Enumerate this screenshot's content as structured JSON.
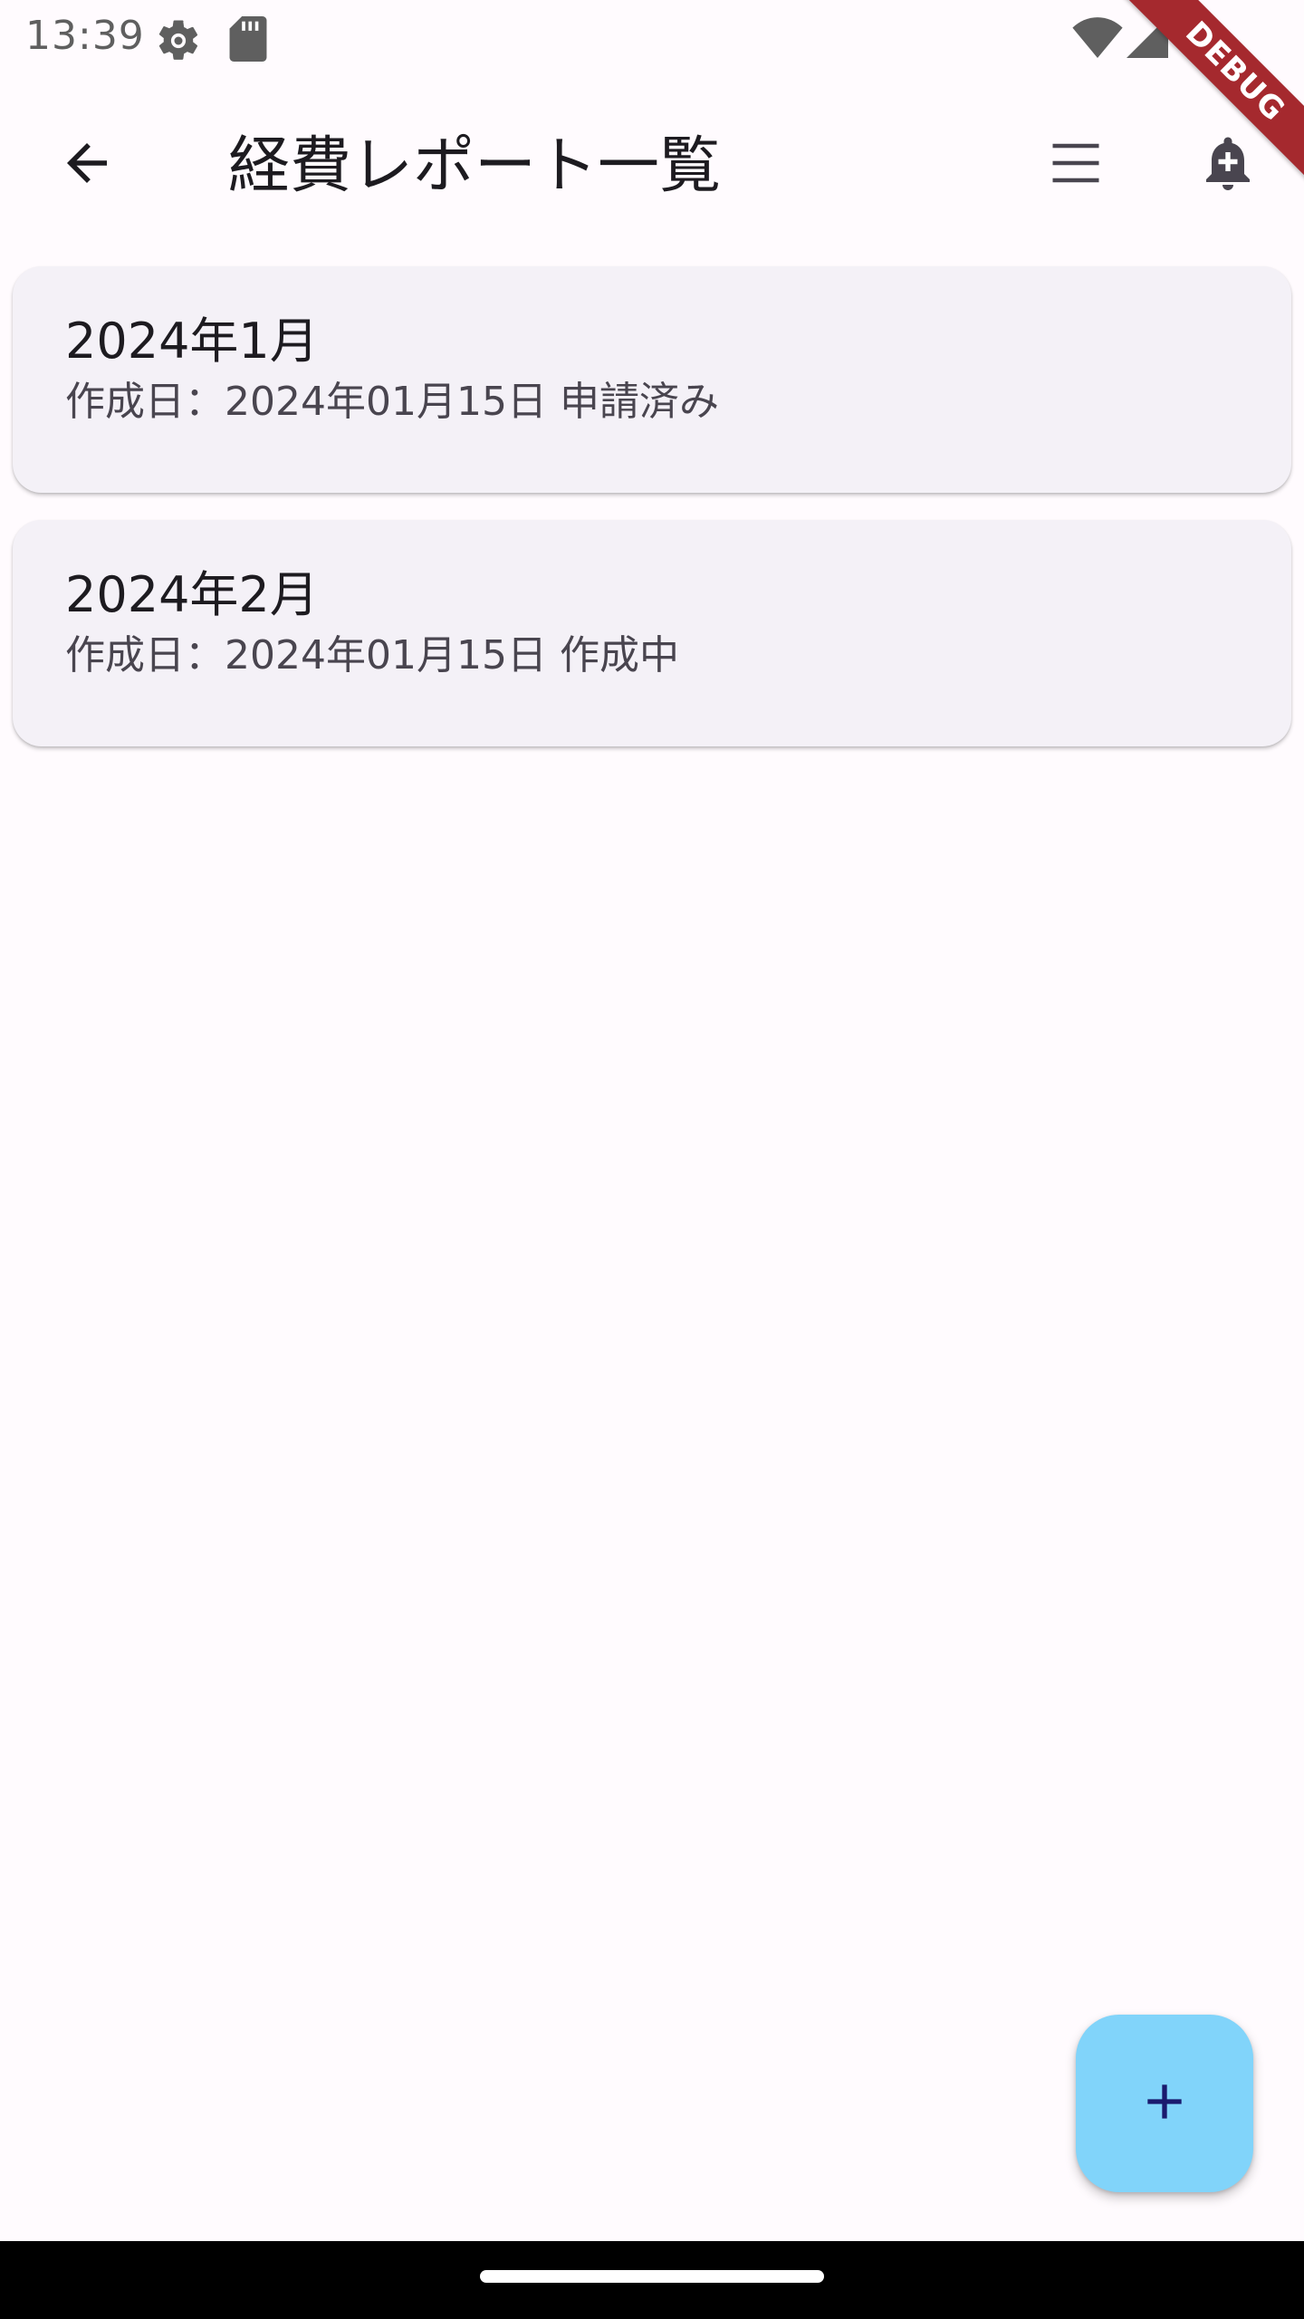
{
  "status_bar": {
    "time": "13:39",
    "icons": [
      "settings-gear-icon",
      "sd-card-icon",
      "wifi-icon",
      "signal-icon",
      "battery-icon"
    ]
  },
  "debug_banner": {
    "label": "DEBUG"
  },
  "app_bar": {
    "title": "経費レポート一覧",
    "back_icon": "arrow-back-icon",
    "menu_icon": "menu-icon",
    "notification_icon": "notification-add-icon"
  },
  "reports": [
    {
      "title": "2024年1月",
      "subtitle": "作成日：2024年01月15日 申請済み"
    },
    {
      "title": "2024年2月",
      "subtitle": "作成日：2024年01月15日 作成中"
    }
  ],
  "fab": {
    "icon": "add-icon"
  },
  "colors": {
    "background": "#fffbfe",
    "card": "#f4f1f7",
    "fab": "#81d4fa",
    "fab_icon": "#1a1a6e",
    "debug": "#a5292e"
  }
}
